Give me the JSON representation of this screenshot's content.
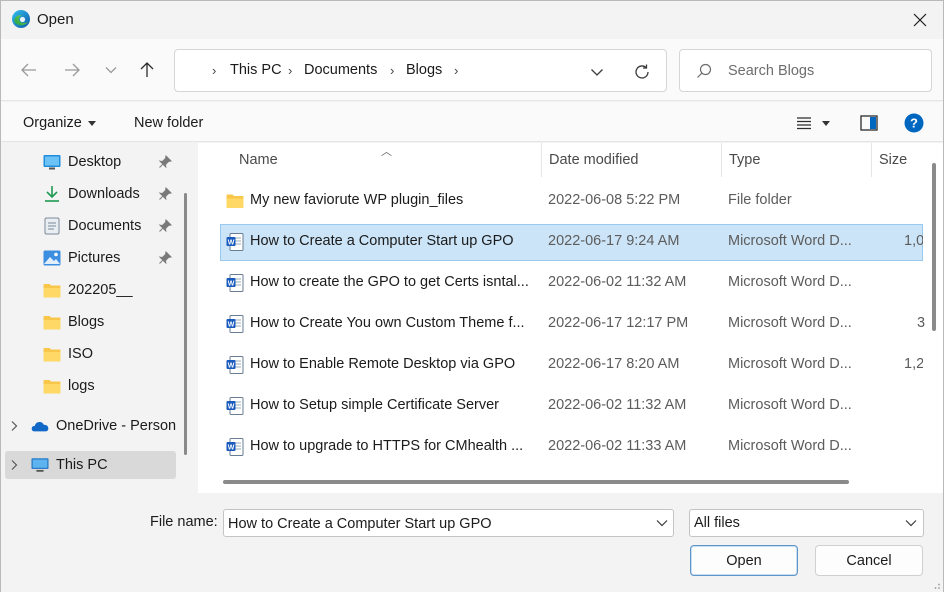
{
  "window": {
    "title": "Open",
    "accent": "#0067c0"
  },
  "nav": {
    "back_icon": "arrow-left-icon",
    "forward_icon": "arrow-right-icon",
    "recent_icon": "chevron-down-icon",
    "up_icon": "arrow-up-icon",
    "breadcrumb": [
      "This PC",
      "Documents",
      "Blogs"
    ],
    "refresh_icon": "refresh-icon"
  },
  "search": {
    "placeholder": "Search Blogs",
    "value": ""
  },
  "toolbar": {
    "organize_label": "Organize",
    "new_folder_label": "New folder"
  },
  "sidebar": {
    "items": [
      {
        "label": "Desktop",
        "icon": "desktop-icon",
        "pinned": true
      },
      {
        "label": "Downloads",
        "icon": "download-icon",
        "pinned": true
      },
      {
        "label": "Documents",
        "icon": "documents-icon",
        "pinned": true
      },
      {
        "label": "Pictures",
        "icon": "pictures-icon",
        "pinned": true
      },
      {
        "label": "202205__",
        "icon": "folder-icon",
        "pinned": false
      },
      {
        "label": "Blogs",
        "icon": "folder-icon",
        "pinned": false
      },
      {
        "label": "ISO",
        "icon": "folder-icon",
        "pinned": false
      },
      {
        "label": "logs",
        "icon": "folder-icon",
        "pinned": false
      },
      {
        "label": "OneDrive - Person",
        "icon": "onedrive-icon",
        "pinned": false
      },
      {
        "label": "This PC",
        "icon": "this-pc-icon",
        "pinned": false
      }
    ]
  },
  "files": {
    "columns": [
      "Name",
      "Date modified",
      "Type",
      "Size"
    ],
    "rows": [
      {
        "name": "My new faviorute WP plugin_files",
        "date": "2022-06-08 5:22 PM",
        "type": "File folder",
        "size": "",
        "icon": "folder-icon"
      },
      {
        "name": "How to Create a Computer Start up GPO",
        "date": "2022-06-17 9:24 AM",
        "type": "Microsoft Word D...",
        "size": "1,0",
        "icon": "word-doc-icon"
      },
      {
        "name": "How to create the GPO to get Certs isntal...",
        "date": "2022-06-02 11:32 AM",
        "type": "Microsoft Word D...",
        "size": "",
        "icon": "word-doc-icon"
      },
      {
        "name": "How to Create You own Custom Theme f...",
        "date": "2022-06-17 12:17 PM",
        "type": "Microsoft Word D...",
        "size": "3",
        "icon": "word-doc-icon"
      },
      {
        "name": "How to Enable Remote Desktop via GPO",
        "date": "2022-06-17 8:20 AM",
        "type": "Microsoft Word D...",
        "size": "1,2",
        "icon": "word-doc-icon"
      },
      {
        "name": "How to Setup simple Certificate Server",
        "date": "2022-06-02 11:32 AM",
        "type": "Microsoft Word D...",
        "size": "",
        "icon": "word-doc-icon"
      },
      {
        "name": "How to upgrade to HTTPS for CMhealth ...",
        "date": "2022-06-02 11:33 AM",
        "type": "Microsoft Word D...",
        "size": "",
        "icon": "word-doc-icon"
      }
    ]
  },
  "footer": {
    "file_name_label": "File name:",
    "file_name_value": "How to Create a Computer Start up GPO",
    "file_type_value": "All files",
    "open_label": "Open",
    "cancel_label": "Cancel"
  }
}
